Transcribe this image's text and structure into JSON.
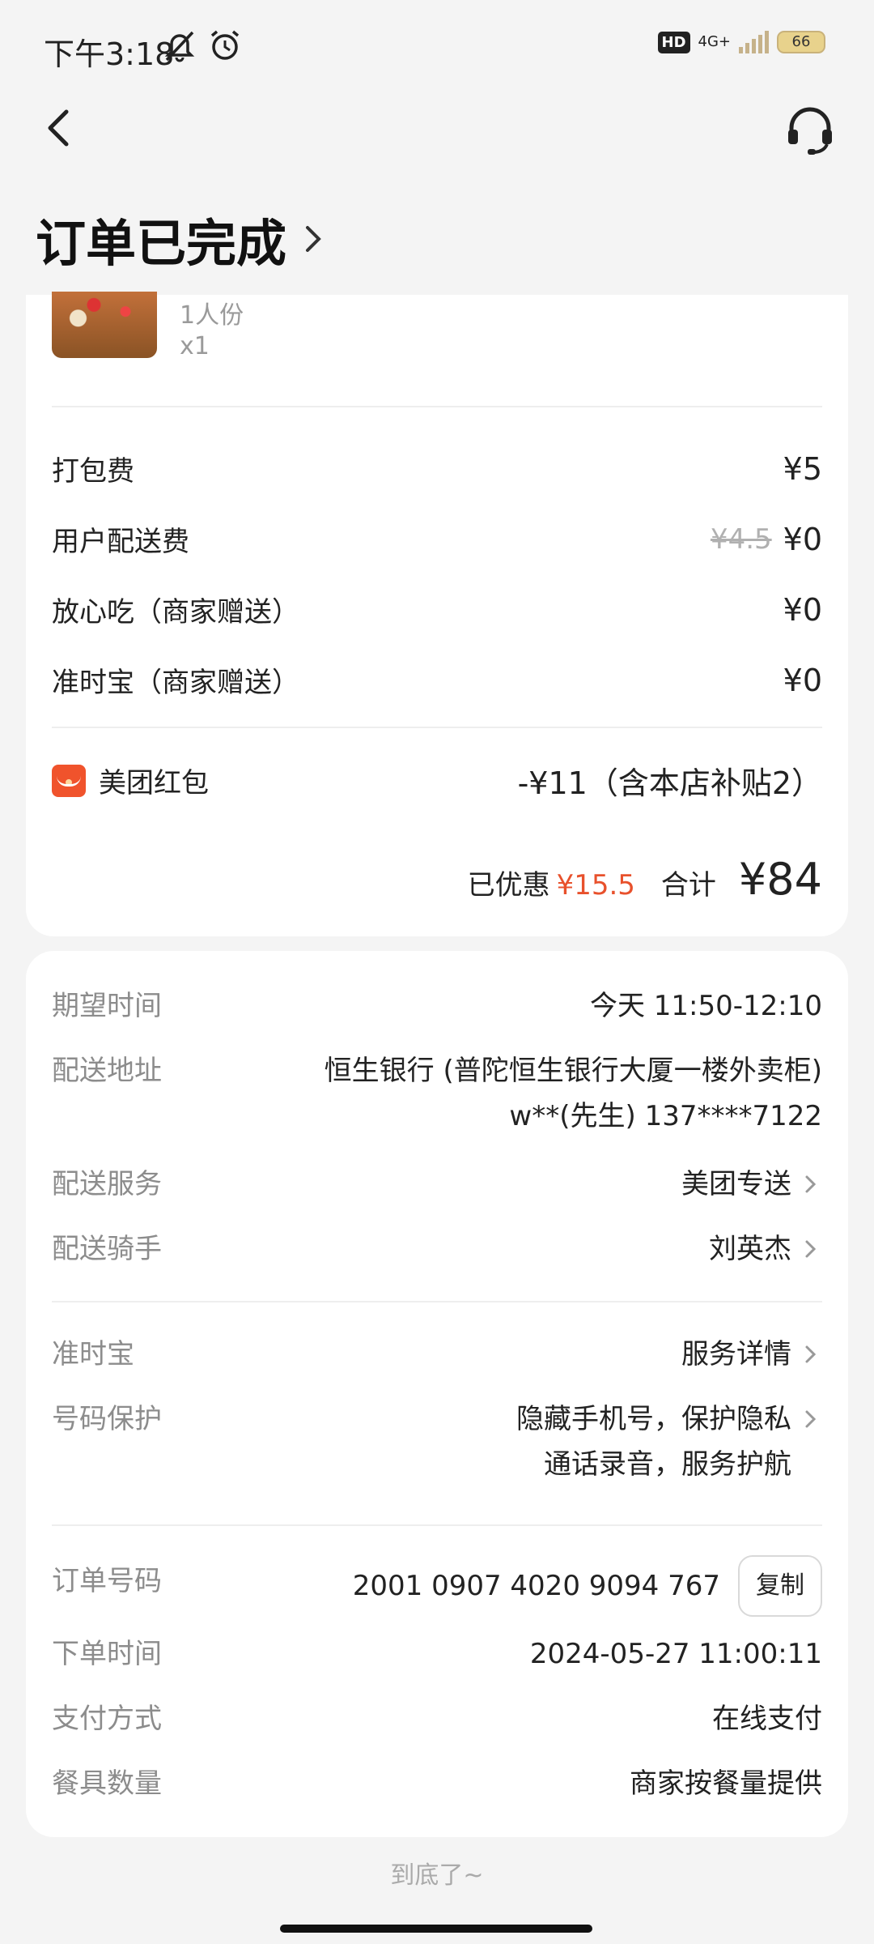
{
  "status_bar": {
    "time": "下午3:18",
    "network": "4G+",
    "hd": "HD",
    "battery": "66"
  },
  "header": {
    "title": "订单已完成"
  },
  "food": {
    "portion": "1人份",
    "quantity": "x1"
  },
  "fees": [
    {
      "label": "打包费",
      "value": "¥5"
    },
    {
      "label": "用户配送费",
      "original": "¥4.5",
      "value": "¥0"
    },
    {
      "label": "放心吃（商家赠送）",
      "value": "¥0"
    },
    {
      "label": "准时宝（商家赠送）",
      "value": "¥0"
    }
  ],
  "redpacket": {
    "label": "美团红包",
    "value": "-¥11（含本店补贴2）"
  },
  "summary": {
    "discount_label": "已优惠",
    "discount": "¥15.5",
    "total_label": "合计",
    "total": "¥84"
  },
  "delivery": {
    "expected_time": {
      "label": "期望时间",
      "value": "今天 11:50-12:10"
    },
    "address": {
      "label": "配送地址",
      "line1": "恒生银行 (普陀恒生银行大厦一楼外卖柜)",
      "line2": "w**(先生) 137****7122"
    },
    "service": {
      "label": "配送服务",
      "value": "美团专送"
    },
    "rider": {
      "label": "配送骑手",
      "value": "刘英杰"
    }
  },
  "guarantee": {
    "ontime": {
      "label": "准时宝",
      "value": "服务详情"
    },
    "privacy": {
      "label": "号码保护",
      "line1": "隐藏手机号，保护隐私",
      "line2": "通话录音，服务护航"
    }
  },
  "order": {
    "number": {
      "label": "订单号码",
      "value": "2001 0907 4020 9094 767",
      "copy": "复制"
    },
    "time": {
      "label": "下单时间",
      "value": "2024-05-27 11:00:11"
    },
    "payment": {
      "label": "支付方式",
      "value": "在线支付"
    },
    "utensils": {
      "label": "餐具数量",
      "value": "商家按餐量提供"
    }
  },
  "footer_note": "到底了~"
}
